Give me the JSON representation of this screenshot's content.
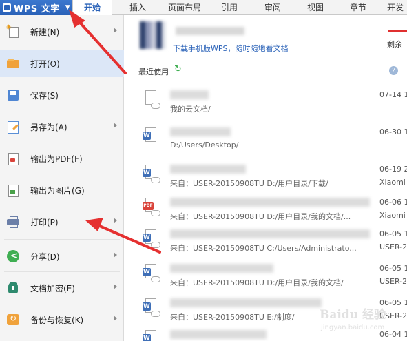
{
  "app": {
    "title": "WPS 文字"
  },
  "tabs": [
    {
      "label": "开始"
    },
    {
      "label": "插入"
    },
    {
      "label": "页面布局"
    },
    {
      "label": "引用"
    },
    {
      "label": "审阅"
    },
    {
      "label": "视图"
    },
    {
      "label": "章节"
    },
    {
      "label": "开发工"
    }
  ],
  "menu": [
    {
      "label": "新建(N)",
      "icon": "new-document-icon",
      "has_submenu": true
    },
    {
      "label": "打开(O)",
      "icon": "folder-open-icon",
      "has_submenu": false,
      "selected": true
    },
    {
      "label": "保存(S)",
      "icon": "save-icon",
      "has_submenu": false
    },
    {
      "label": "另存为(A)",
      "icon": "save-as-icon",
      "has_submenu": true
    },
    {
      "label": "输出为PDF(F)",
      "icon": "export-pdf-icon",
      "has_submenu": false
    },
    {
      "label": "输出为图片(G)",
      "icon": "export-image-icon",
      "has_submenu": false
    },
    {
      "label": "打印(P)",
      "icon": "printer-icon",
      "has_submenu": true
    },
    {
      "label": "分享(D)",
      "icon": "share-icon",
      "has_submenu": true
    },
    {
      "label": "文档加密(E)",
      "icon": "encrypt-icon",
      "has_submenu": true
    },
    {
      "label": "备份与恢复(K)",
      "icon": "backup-icon",
      "has_submenu": true
    }
  ],
  "promo": {
    "link": "下载手机版WPS，随时随地看文档",
    "remain_label": "剩余"
  },
  "recent": {
    "title": "最近使用"
  },
  "files": [
    {
      "type": "cloud",
      "path": "我的云文档/",
      "date": "07-14 1",
      "source": ""
    },
    {
      "type": "word",
      "path": "D:/Users/Desktop/",
      "date": "06-30 1",
      "source": ""
    },
    {
      "type": "word-cloud",
      "path": "来自：USER-20150908TU D:/用户目录/下载/",
      "date": "06-19 2",
      "source": "Xiaomi"
    },
    {
      "type": "pdf",
      "path": "来自：USER-20150908TU D:/用户目录/我的文档/...",
      "date": "06-06 1",
      "source": "Xiaomi"
    },
    {
      "type": "word-cloud",
      "path": "来自：USER-20150908TU C:/Users/Administrato...",
      "date": "06-05 1",
      "source": "USER-2"
    },
    {
      "type": "word-cloud",
      "path": "来自：USER-20150908TU D:/用户目录/我的文档/",
      "date": "06-05 1",
      "source": "USER-2"
    },
    {
      "type": "word-cloud",
      "path": "来自：USER-20150908TU E:/制度/",
      "date": "06-05 1",
      "source": "USER-2"
    },
    {
      "type": "word",
      "path": "",
      "date": "06-04 1",
      "source": ""
    }
  ],
  "watermark": {
    "text": "Baidu 经验",
    "url": "jingyan.baidu.com"
  },
  "colors": {
    "accent": "#2a62b8",
    "annotation_arrow": "#e53030",
    "selected_menu_bg": "#dce7f7"
  }
}
